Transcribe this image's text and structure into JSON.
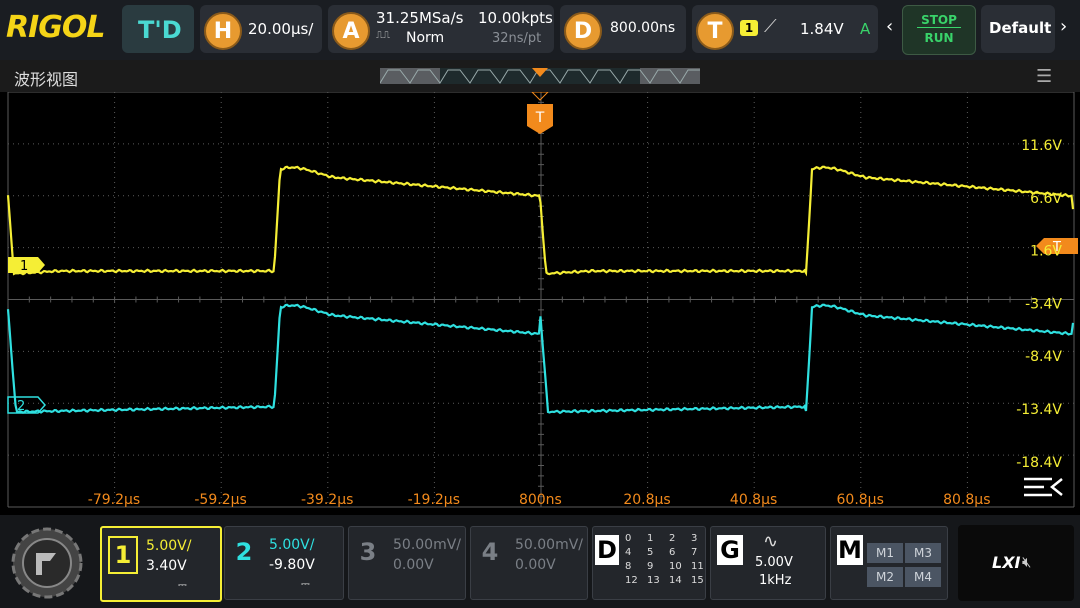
{
  "topbar": {
    "logo": "RIGOL",
    "mode": "T'D",
    "horizontal": {
      "letter": "H",
      "scale": "20.00μs/"
    },
    "acquire": {
      "letter": "A",
      "sample_rate": "31.25MSa/s",
      "mode": "Norm",
      "points": "10.00kpts",
      "resolution": "32ns/pt"
    },
    "delay": {
      "letter": "D",
      "value": "800.00ns"
    },
    "trigger": {
      "letter": "T",
      "source": "1",
      "level": "1.84V",
      "sweep": "A"
    },
    "stop_label": "STOP",
    "run_label": "RUN",
    "default_label": "Default"
  },
  "view": {
    "title": "波形视图"
  },
  "scope": {
    "trigger_marker": "T",
    "ch1_marker": "1",
    "ch2_marker": "2",
    "right_trigger_marker": "T",
    "y_labels": [
      "11.6V",
      "6.6V",
      "1.6V",
      "-3.4V",
      "-8.4V",
      "-13.4V",
      "-18.4V"
    ],
    "x_labels": [
      "-79.2μs",
      "-59.2μs",
      "-39.2μs",
      "-19.2μs",
      "800ns",
      "20.8μs",
      "40.8μs",
      "60.8μs",
      "80.8μs"
    ],
    "colors": {
      "ch1": "#f5ee35",
      "ch2": "#2fe0e0",
      "accent": "#f28a1c",
      "grid": "#5a5a5a"
    }
  },
  "bottombar": {
    "ch1": {
      "num": "1",
      "scale": "5.00V/",
      "offset": "3.40V"
    },
    "ch2": {
      "num": "2",
      "scale": "5.00V/",
      "offset": "-9.80V"
    },
    "ch3": {
      "num": "3",
      "scale": "50.00mV/",
      "offset": "0.00V"
    },
    "ch4": {
      "num": "4",
      "scale": "50.00mV/",
      "offset": "0.00V"
    },
    "digital": {
      "label": "D",
      "channels": [
        "0",
        "1",
        "2",
        "3",
        "4",
        "5",
        "6",
        "7",
        "8",
        "9",
        "10",
        "11",
        "12",
        "13",
        "14",
        "15"
      ]
    },
    "generator": {
      "label": "G",
      "amplitude": "5.00V",
      "frequency": "1kHz"
    },
    "math": {
      "label": "M",
      "items": [
        "M1",
        "M3",
        "M2",
        "M4"
      ]
    },
    "lxi": "LXI"
  }
}
